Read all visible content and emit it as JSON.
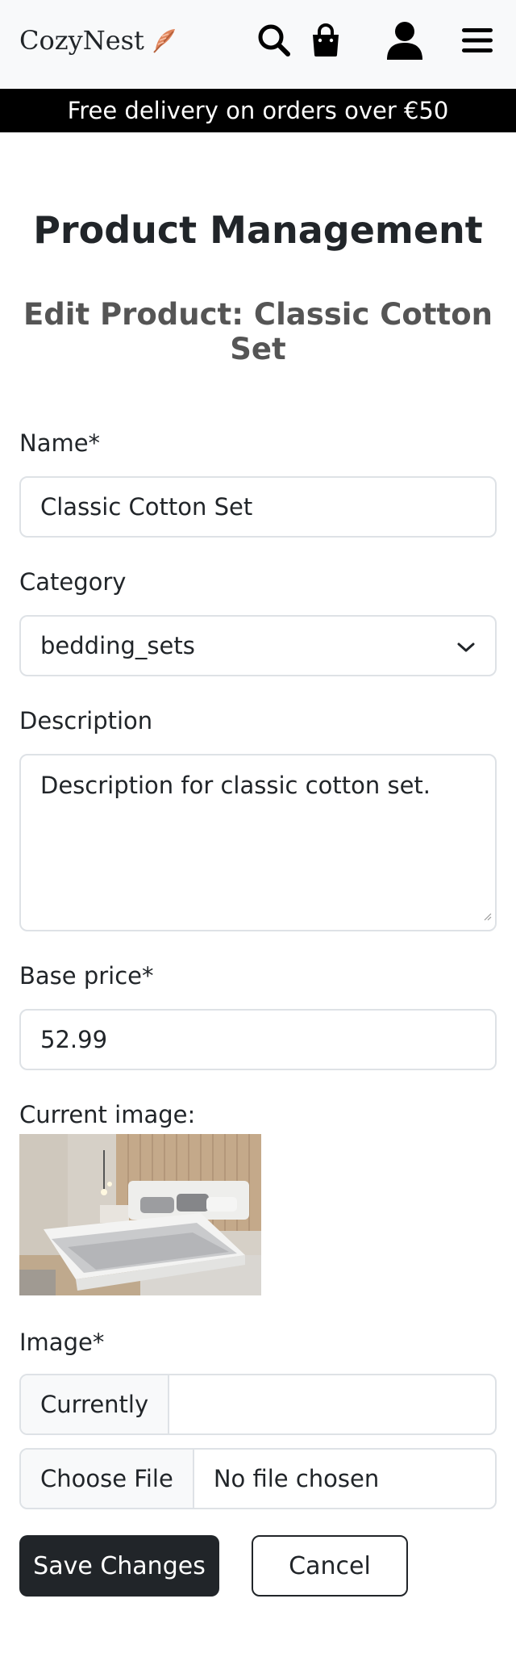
{
  "header": {
    "brand": "CozyNest",
    "icons": [
      "feather-icon",
      "search-icon",
      "shopping-bag-icon",
      "user-icon",
      "menu-icon"
    ]
  },
  "banner": {
    "text": "Free delivery on orders over €50"
  },
  "page": {
    "title": "Product Management",
    "subtitle": "Edit Product: Classic Cotton Set"
  },
  "form": {
    "name_label": "Name*",
    "name_value": "Classic Cotton Set",
    "category_label": "Category",
    "category_value": "bedding_sets",
    "description_label": "Description",
    "description_value": "Description for classic cotton set.",
    "price_label": "Base price*",
    "price_value": "52.99",
    "current_image_label": "Current image:",
    "image_label": "Image*",
    "currently_label": "Currently",
    "currently_value": "",
    "choose_file_label": "Choose File",
    "no_file_text": "No file chosen",
    "save_label": "Save Changes",
    "cancel_label": "Cancel"
  },
  "colors": {
    "accent": "#212529",
    "banner_bg": "#000000",
    "navbar_bg": "#f8f9fa",
    "feather": "#e0855c"
  }
}
